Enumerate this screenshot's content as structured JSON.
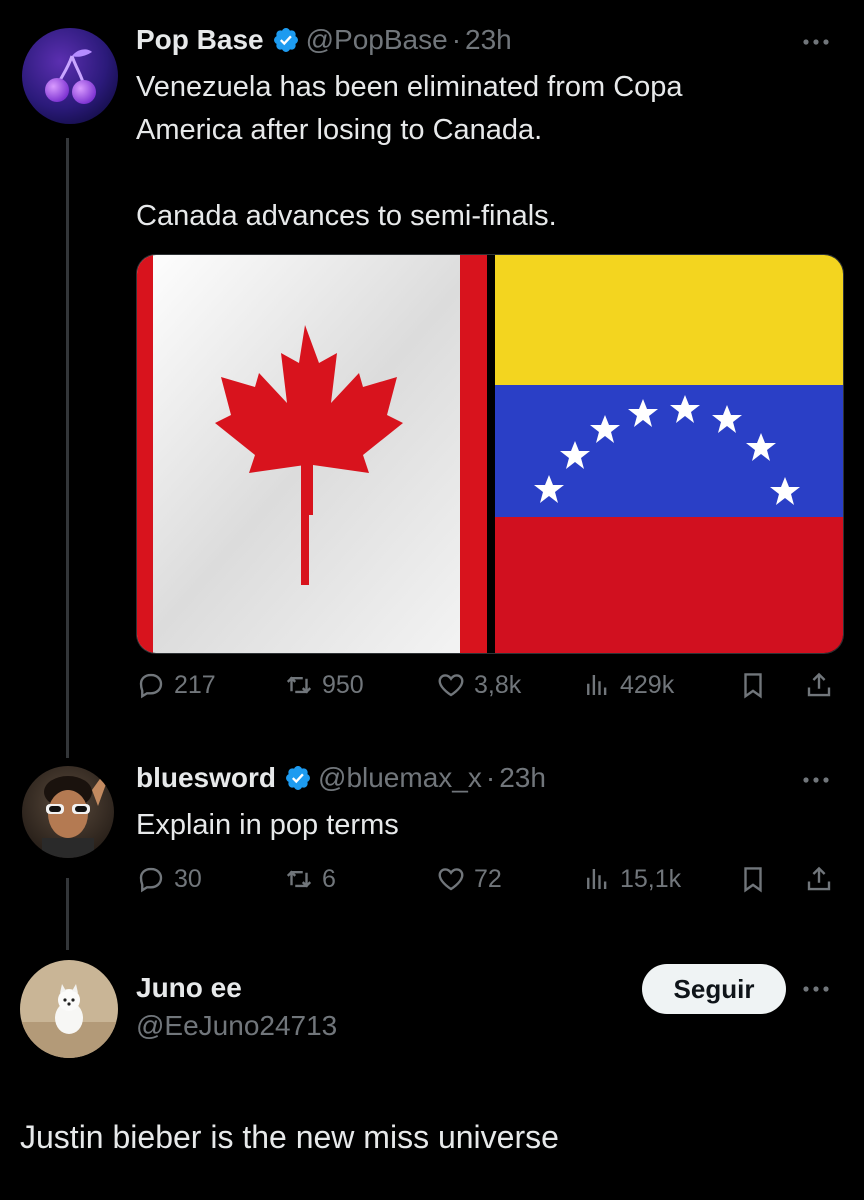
{
  "tweet1": {
    "name": "Pop Base",
    "handle": "@PopBase",
    "separator": "·",
    "time": "23h",
    "text": "Venezuela has been eliminated from Copa\nAmerica after losing to Canada.\n\nCanada advances to semi-finals.",
    "media": {
      "left_flag": "Canada flag",
      "right_flag": "Venezuela flag"
    },
    "actions": {
      "replies": "217",
      "reposts": "950",
      "likes": "3,8k",
      "views": "429k"
    }
  },
  "tweet2": {
    "name": "bluesword",
    "handle": "@bluemax_x",
    "separator": "·",
    "time": "23h",
    "text": "Explain in pop terms",
    "actions": {
      "replies": "30",
      "reposts": "6",
      "likes": "72",
      "views": "15,1k"
    }
  },
  "tweet3": {
    "name": "Juno ee",
    "handle": "@EeJuno24713",
    "follow_label": "Seguir",
    "text": "Justin bieber is the new miss universe"
  },
  "icons": {
    "verified": "verified-badge-icon",
    "more": "more-icon",
    "reply": "reply-icon",
    "repost": "repost-icon",
    "like": "like-icon",
    "views": "views-icon",
    "bookmark": "bookmark-icon",
    "share": "share-icon"
  },
  "colors": {
    "background": "#000000",
    "text": "#e7e9ea",
    "secondary": "#71767b",
    "verified": "#1d9bf0",
    "thread_line": "#333639"
  }
}
